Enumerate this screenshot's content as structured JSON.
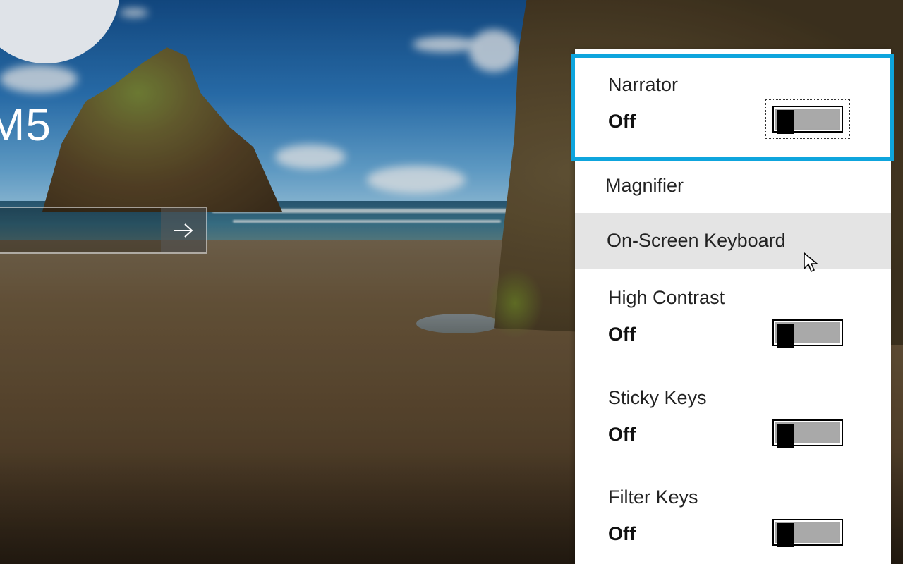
{
  "lock_screen": {
    "username": "M5",
    "password_placeholder": "",
    "submit_icon": "arrow-right-icon"
  },
  "ease_of_access": {
    "items": [
      {
        "label": "Narrator",
        "state": "Off",
        "toggle_on": false,
        "focused": true
      },
      {
        "label": "Magnifier"
      },
      {
        "label": "On-Screen Keyboard",
        "hovered": true
      },
      {
        "label": "High Contrast",
        "state": "Off",
        "toggle_on": false
      },
      {
        "label": "Sticky Keys",
        "state": "Off",
        "toggle_on": false
      },
      {
        "label": "Filter Keys",
        "state": "Off",
        "toggle_on": false
      }
    ]
  },
  "colors": {
    "focus_ring": "#0ea5dd",
    "hover_bg": "#e4e4e4",
    "panel_bg": "#ffffff"
  }
}
